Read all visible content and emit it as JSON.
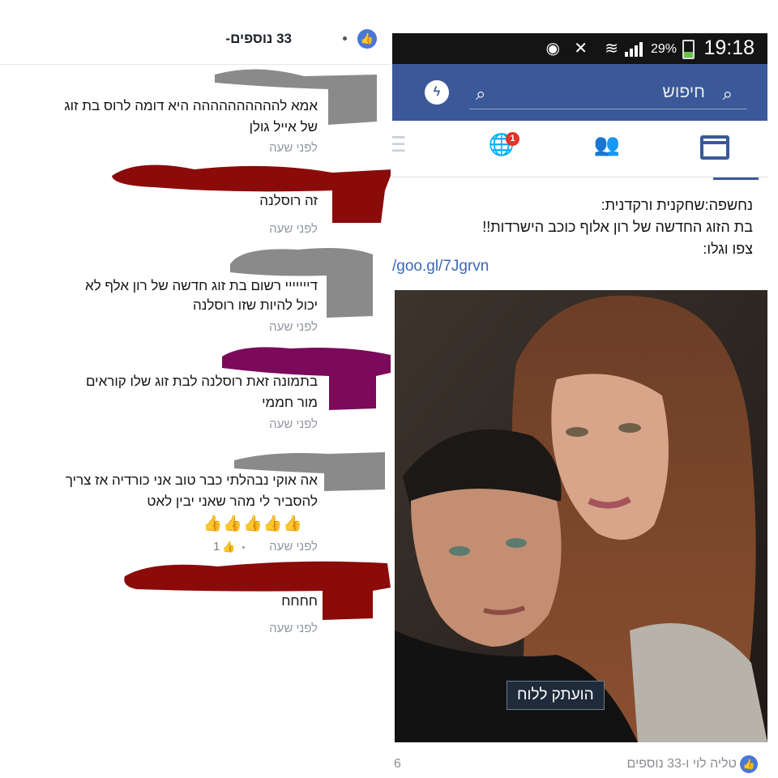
{
  "comments_header": {
    "count_label": "33 נוספים-"
  },
  "comments": [
    {
      "text_lines": [
        "אמא להההההההההה היא דומה לרוס בת זוג",
        "של אייל גולן"
      ],
      "time": "לפני שעה"
    },
    {
      "text_lines": [
        "זה רוסלנה"
      ],
      "time": "לפני שעה"
    },
    {
      "text_lines": [
        "דייייייי רשום בת זוג חדשה של רון אלף לא",
        "יכול להיות  שזו רוסלנה"
      ],
      "time": "לפני שעה"
    },
    {
      "text_lines": [
        "בתמונה זאת רוסלנה לבת זוג שלו קוראים",
        "מור חממי"
      ],
      "time": "לפני שעה"
    },
    {
      "text_lines": [
        "אה אוקי נבהלתי כבר טוב אני כורדיה אז צריך",
        "להסביר לי מהר שאני יבין לאט"
      ],
      "thumbs": "👍👍👍👍👍",
      "time": "לפני שעה",
      "likes": "1"
    },
    {
      "text_lines": [
        "חחחח"
      ],
      "time": "לפני שעה"
    }
  ],
  "status_bar": {
    "time": "19:18",
    "battery": "29%"
  },
  "topbar": {
    "search_placeholder": "חיפוש"
  },
  "tabs": {
    "notification_badge": "1"
  },
  "post": {
    "text_lines": [
      "נחשפה:שחקנית ורקדנית:",
      "בת הזוג החדשה של רון אלוף כוכב הישרדות!!",
      "צפו וגלו:"
    ],
    "link": "/goo.gl/7Jgrvn",
    "toast": "הועתק ללוח",
    "footer_likers": "טליה לוי ו-33 נוספים",
    "footer_count": "6 ‏"
  },
  "colors": {
    "facebook_blue": "#3b5998",
    "badge_red": "#e3332a",
    "scribble_gray": "#8a8a8a",
    "scribble_red": "#8b0a0a",
    "scribble_purple": "#7c0a5a"
  }
}
